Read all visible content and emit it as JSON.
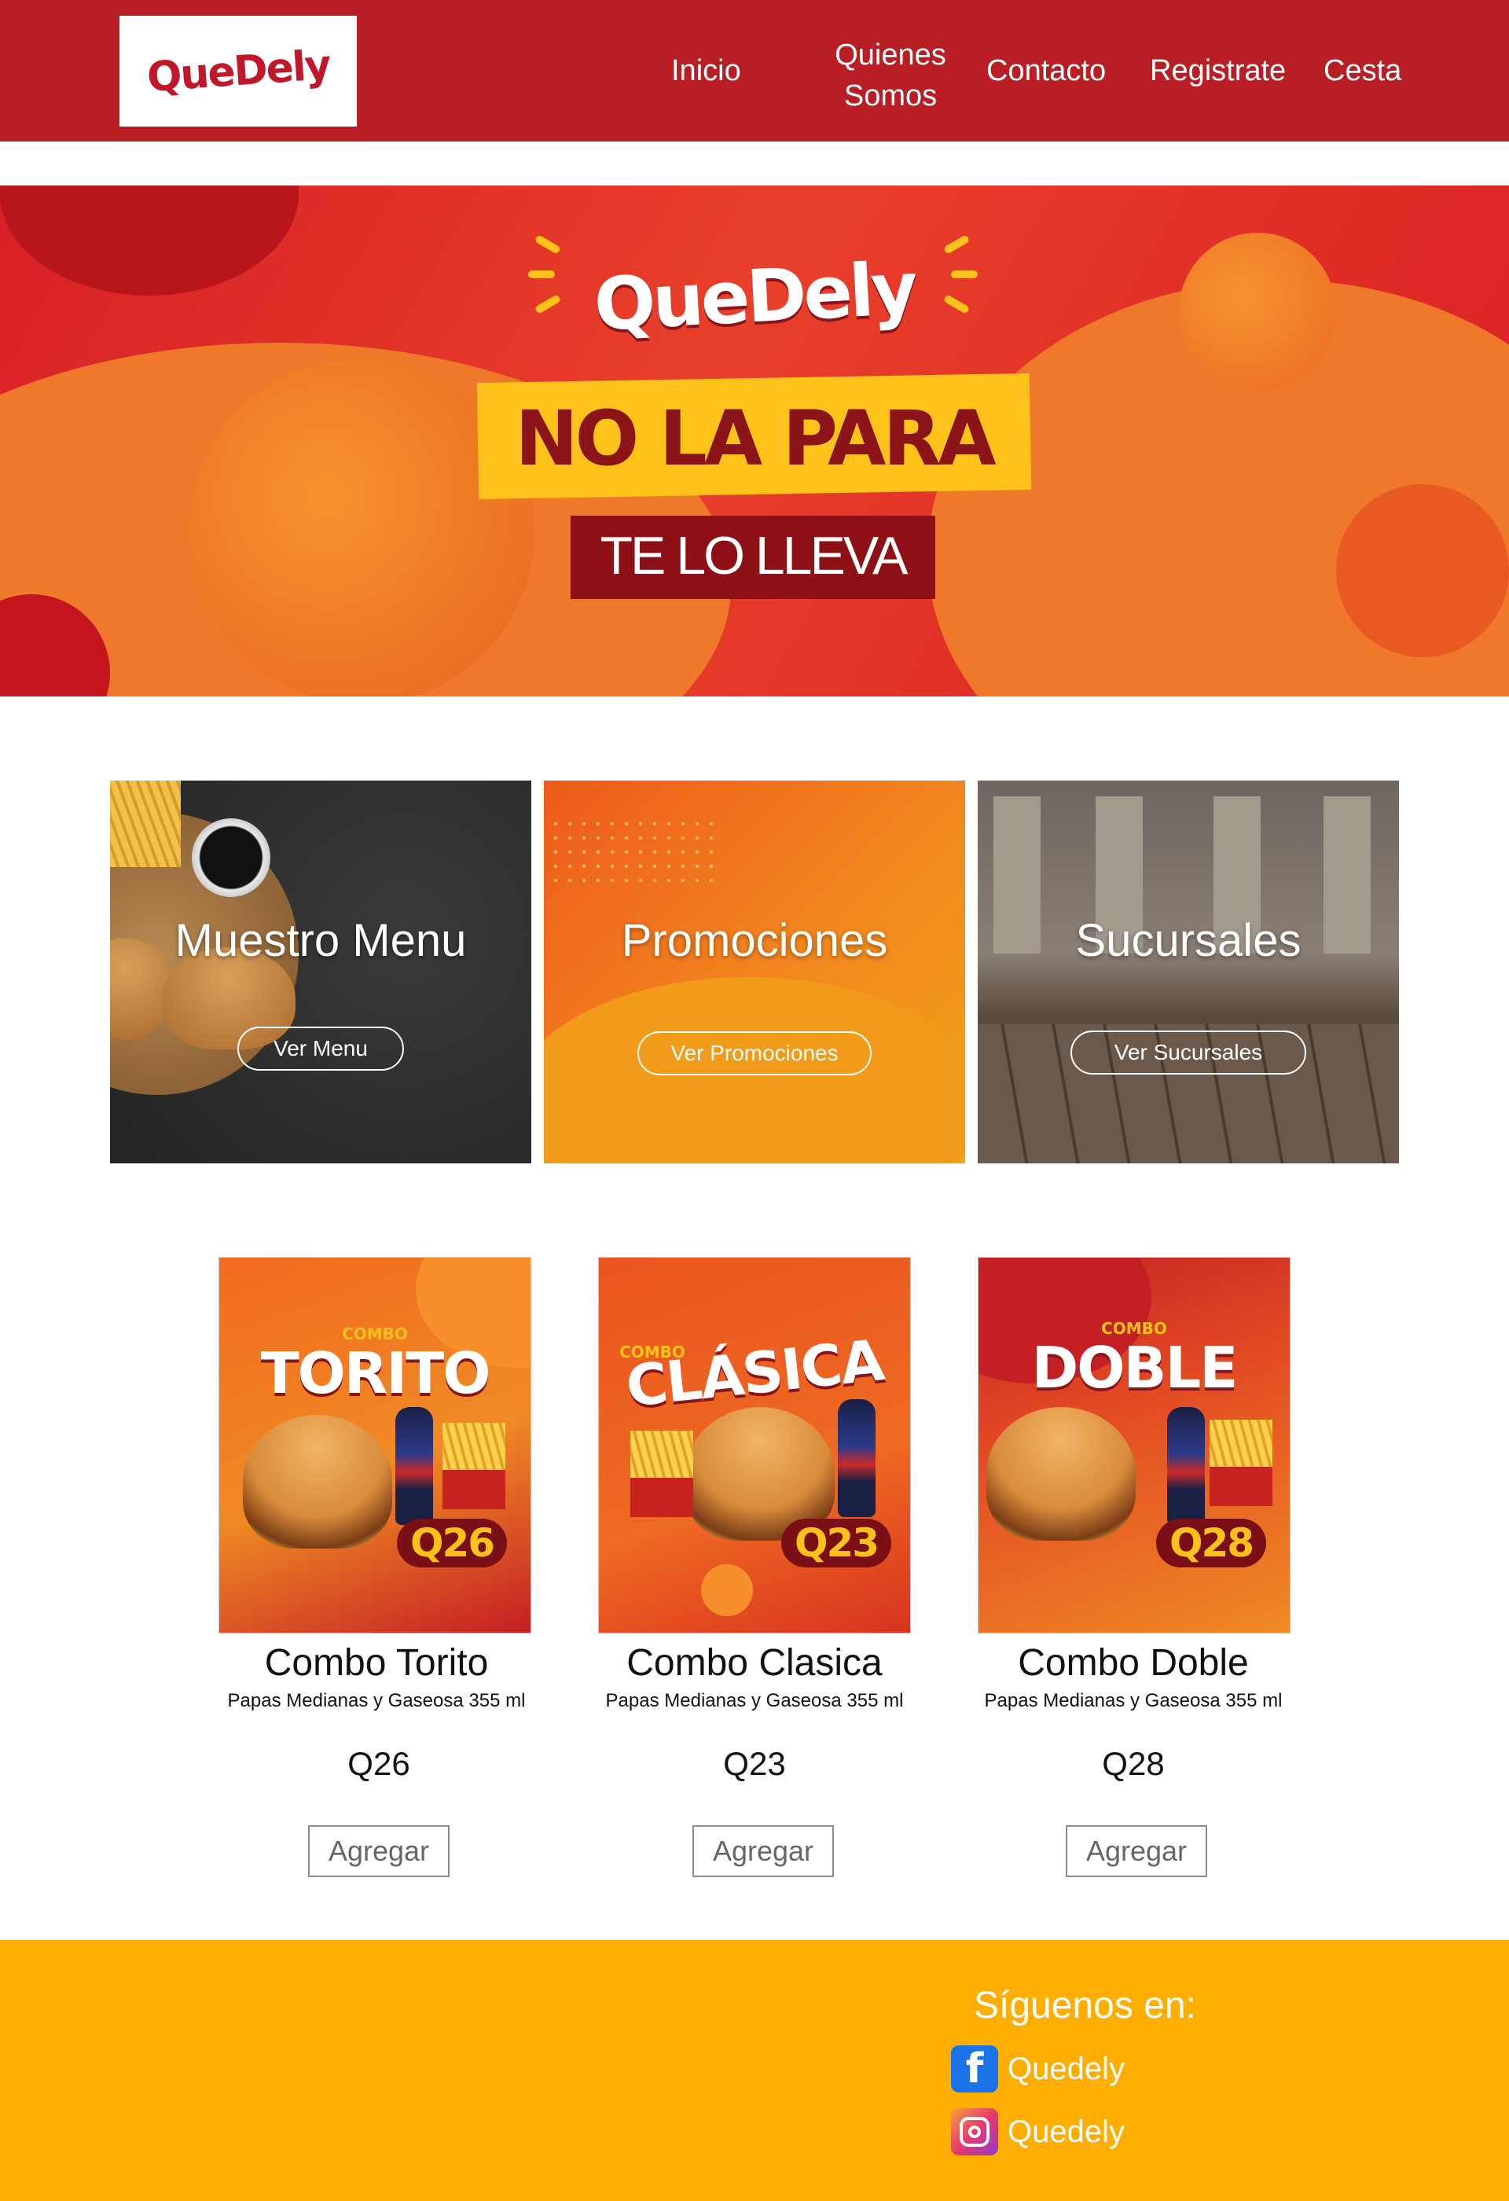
{
  "header": {
    "logo_text": "QueDely",
    "nav": [
      {
        "label": "Inicio"
      },
      {
        "label": "Quienes Somos"
      },
      {
        "label": "Contacto"
      },
      {
        "label": "Registrate"
      },
      {
        "label": "Cesta"
      }
    ]
  },
  "hero": {
    "brand": "QueDely",
    "headline": "NO LA PARA",
    "subline": "TE LO LLEVA",
    "colors": {
      "red": "#d81f26",
      "orange": "#f0782a",
      "yellow": "#ffc21a",
      "dark_red": "#8c1016"
    }
  },
  "categories": [
    {
      "title": "Muestro Menu",
      "button": "Ver Menu"
    },
    {
      "title": "Promociones",
      "button": "Ver Promociones"
    },
    {
      "title": "Sucursales",
      "button": "Ver Sucursales"
    }
  ],
  "products": [
    {
      "image_tag": "COMBO",
      "image_title": "TORITO",
      "image_price": "Q26",
      "name": "Combo Torito",
      "description": "Papas Medianas y Gaseosa 355 ml",
      "price": "Q26",
      "button": "Agregar"
    },
    {
      "image_tag": "COMBO",
      "image_title": "CLÁSICA",
      "image_price": "Q23",
      "name": "Combo Clasica",
      "description": "Papas Medianas y Gaseosa 355 ml",
      "price": "Q23",
      "button": "Agregar"
    },
    {
      "image_tag": "COMBO",
      "image_title": "DOBLE",
      "image_price": "Q28",
      "name": "Combo Doble",
      "description": "Papas Medianas y Gaseosa 355 ml",
      "price": "Q28",
      "button": "Agregar"
    }
  ],
  "footer": {
    "follow_title": "Síguenos en:",
    "social": [
      {
        "network_icon": "facebook-icon",
        "label": "Quedely"
      },
      {
        "network_icon": "instagram-icon",
        "label": "Quedely"
      }
    ],
    "colors": {
      "background": "#fdae00",
      "header": "#b81e23"
    }
  }
}
